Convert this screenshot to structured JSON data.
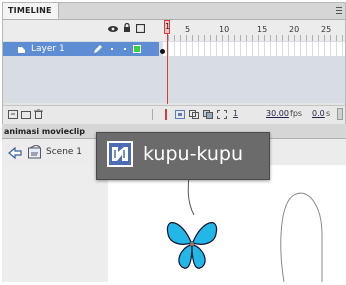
{
  "timeline": {
    "tab_label": "TIMELINE",
    "ruler": [
      "1",
      "5",
      "10",
      "15",
      "20",
      "25"
    ],
    "layer_name": "Layer 1",
    "fps": "30.00",
    "fps_unit": "fps",
    "time": "0.0",
    "time_unit": "s",
    "current_frame": "1"
  },
  "movieclip_panel": {
    "tab_label": "animasi movieclip"
  },
  "edit_bar": {
    "scene_label": "Scene 1"
  },
  "tooltip": {
    "symbol_name": "kupu-kupu"
  },
  "colors": {
    "butterfly": "#22b7e6",
    "layer_highlight": "#5f8dd3",
    "playhead": "#d04040"
  }
}
